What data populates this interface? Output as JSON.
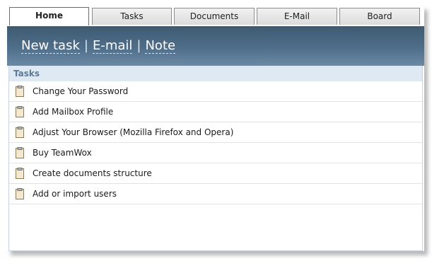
{
  "tabs": [
    {
      "label": "Home",
      "active": true
    },
    {
      "label": "Tasks",
      "active": false
    },
    {
      "label": "Documents",
      "active": false
    },
    {
      "label": "E-Mail",
      "active": false
    },
    {
      "label": "Board",
      "active": false
    }
  ],
  "header": {
    "links": [
      "New task",
      "E-mail",
      "Note"
    ],
    "separator": "|"
  },
  "section": {
    "title": "Tasks"
  },
  "tasks": [
    {
      "label": "Change Your Password",
      "icon": "clipboard-icon"
    },
    {
      "label": "Add Mailbox Profile",
      "icon": "clipboard-icon"
    },
    {
      "label": "Adjust Your Browser (Mozilla Firefox and Opera)",
      "icon": "clipboard-icon"
    },
    {
      "label": "Buy TeamWox",
      "icon": "clipboard-icon"
    },
    {
      "label": "Create documents structure",
      "icon": "clipboard-icon"
    },
    {
      "label": "Add or import users",
      "icon": "clipboard-icon"
    }
  ],
  "colors": {
    "header_band": "#4f6e8a",
    "section_bg": "#dfe9f3",
    "section_text": "#5d7a96"
  }
}
